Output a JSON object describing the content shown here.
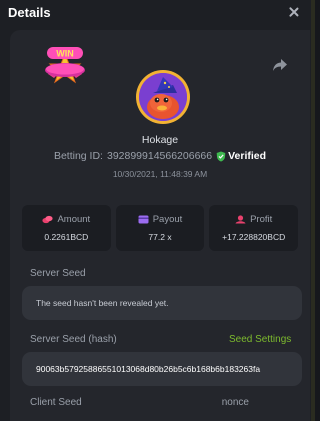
{
  "modal": {
    "title": "Details"
  },
  "bet": {
    "username": "Hokage",
    "betting_id_label": "Betting ID:",
    "betting_id": "392899914566206666",
    "verified_label": "Verified",
    "datetime": "10/30/2021, 11:48:39 AM"
  },
  "stats": [
    {
      "label": "Amount",
      "value": "0.2261BCD",
      "icon": "coins-icon",
      "color": "#e8416d"
    },
    {
      "label": "Payout",
      "value": "77.2 x",
      "icon": "card-icon",
      "color": "#9b6cf0"
    },
    {
      "label": "Profit",
      "value": "+17.228820BCD",
      "icon": "profit-icon",
      "color": "#e8416d"
    }
  ],
  "server_seed": {
    "label": "Server Seed",
    "message": "The seed hasn't been revealed yet."
  },
  "server_seed_hash": {
    "label": "Server Seed (hash)",
    "settings_link": "Seed Settings",
    "value": "90063b57925886551013068d80b26b5c6b168b6b183263fa"
  },
  "client_seed": {
    "label": "Client Seed",
    "nonce_label": "nonce"
  },
  "colors": {
    "accent_green": "#7dbb2e",
    "panel": "#24262c",
    "field": "#31343b"
  }
}
